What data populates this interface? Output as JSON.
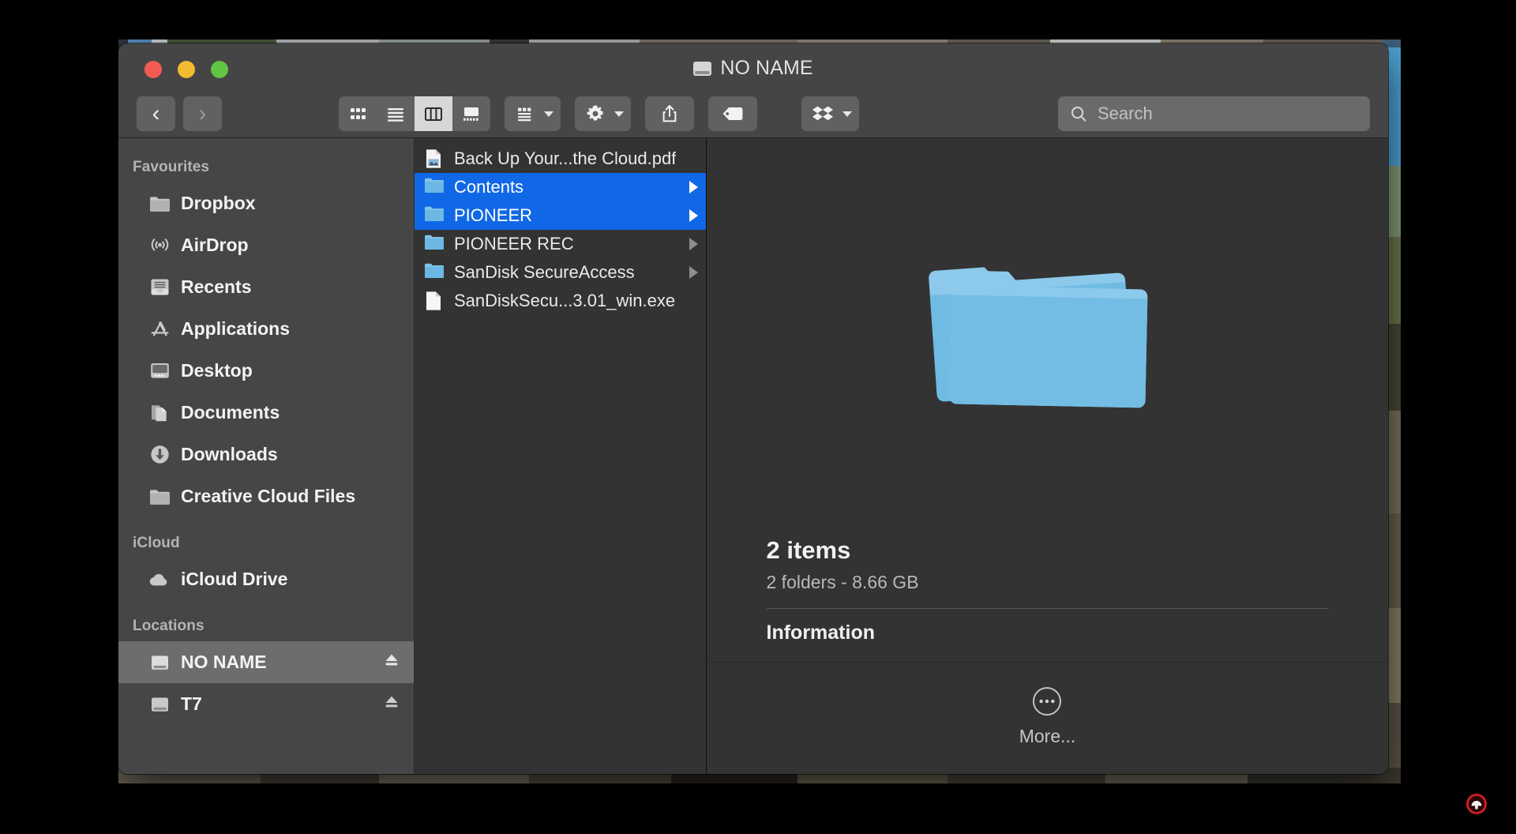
{
  "window": {
    "title": "NO NAME",
    "title_icon": "drive-icon",
    "traffic_lights": [
      {
        "name": "close",
        "color": "#f35b52"
      },
      {
        "name": "minimize",
        "color": "#f1bc2f"
      },
      {
        "name": "maximize",
        "color": "#62c445"
      }
    ]
  },
  "toolbar": {
    "back_label": "‹",
    "forward_label": "›",
    "view_modes": [
      {
        "name": "icon-view",
        "selected": false
      },
      {
        "name": "list-view",
        "selected": false
      },
      {
        "name": "column-view",
        "selected": true
      },
      {
        "name": "gallery-view",
        "selected": false
      }
    ],
    "group_button": "group-by-icon",
    "action_button": "gear-icon",
    "share_button": "share-icon",
    "tags_button": "tag-icon",
    "dropbox_button": "dropbox-icon"
  },
  "search": {
    "placeholder": "Search",
    "value": ""
  },
  "sidebar": {
    "sections": [
      {
        "header": "Favourites",
        "items": [
          {
            "label": "Dropbox",
            "icon": "folder-icon",
            "selected": false,
            "eject": false
          },
          {
            "label": "AirDrop",
            "icon": "airdrop-icon",
            "selected": false,
            "eject": false
          },
          {
            "label": "Recents",
            "icon": "recents-icon",
            "selected": false,
            "eject": false
          },
          {
            "label": "Applications",
            "icon": "applications-icon",
            "selected": false,
            "eject": false
          },
          {
            "label": "Desktop",
            "icon": "desktop-icon",
            "selected": false,
            "eject": false
          },
          {
            "label": "Documents",
            "icon": "documents-icon",
            "selected": false,
            "eject": false
          },
          {
            "label": "Downloads",
            "icon": "downloads-icon",
            "selected": false,
            "eject": false
          },
          {
            "label": "Creative Cloud Files",
            "icon": "folder-icon",
            "selected": false,
            "eject": false
          }
        ]
      },
      {
        "header": "iCloud",
        "items": [
          {
            "label": "iCloud Drive",
            "icon": "cloud-icon",
            "selected": false,
            "eject": false
          }
        ]
      },
      {
        "header": "Locations",
        "items": [
          {
            "label": "NO NAME",
            "icon": "drive-icon",
            "selected": true,
            "eject": true
          },
          {
            "label": "T7",
            "icon": "drive-icon",
            "selected": false,
            "eject": true
          }
        ]
      }
    ]
  },
  "file_list": {
    "items": [
      {
        "name": "Back Up Your...the Cloud.pdf",
        "icon": "pdf-file-icon",
        "selected": false,
        "has_arrow": false
      },
      {
        "name": "Contents",
        "icon": "folder-icon",
        "selected": true,
        "has_arrow": true
      },
      {
        "name": "PIONEER",
        "icon": "folder-icon",
        "selected": true,
        "has_arrow": true
      },
      {
        "name": "PIONEER REC",
        "icon": "folder-icon",
        "selected": false,
        "has_arrow": true
      },
      {
        "name": "SanDisk SecureAccess",
        "icon": "folder-icon",
        "selected": false,
        "has_arrow": true
      },
      {
        "name": "SanDiskSecu...3.01_win.exe",
        "icon": "exe-file-icon",
        "selected": false,
        "has_arrow": false
      }
    ]
  },
  "preview": {
    "thumbnail": "stacked-folders-icon",
    "item_count": "2 items",
    "detail": "2 folders - 8.66 GB",
    "information_header": "Information",
    "more_label": "More...",
    "more_icon": "ellipsis-circle-icon"
  },
  "colors": {
    "selection_blue": "#1168e6",
    "window_chrome": "#454545",
    "sidebar_bg": "#464646",
    "content_bg": "#333333",
    "folder_blue": "#6cb8e4"
  }
}
